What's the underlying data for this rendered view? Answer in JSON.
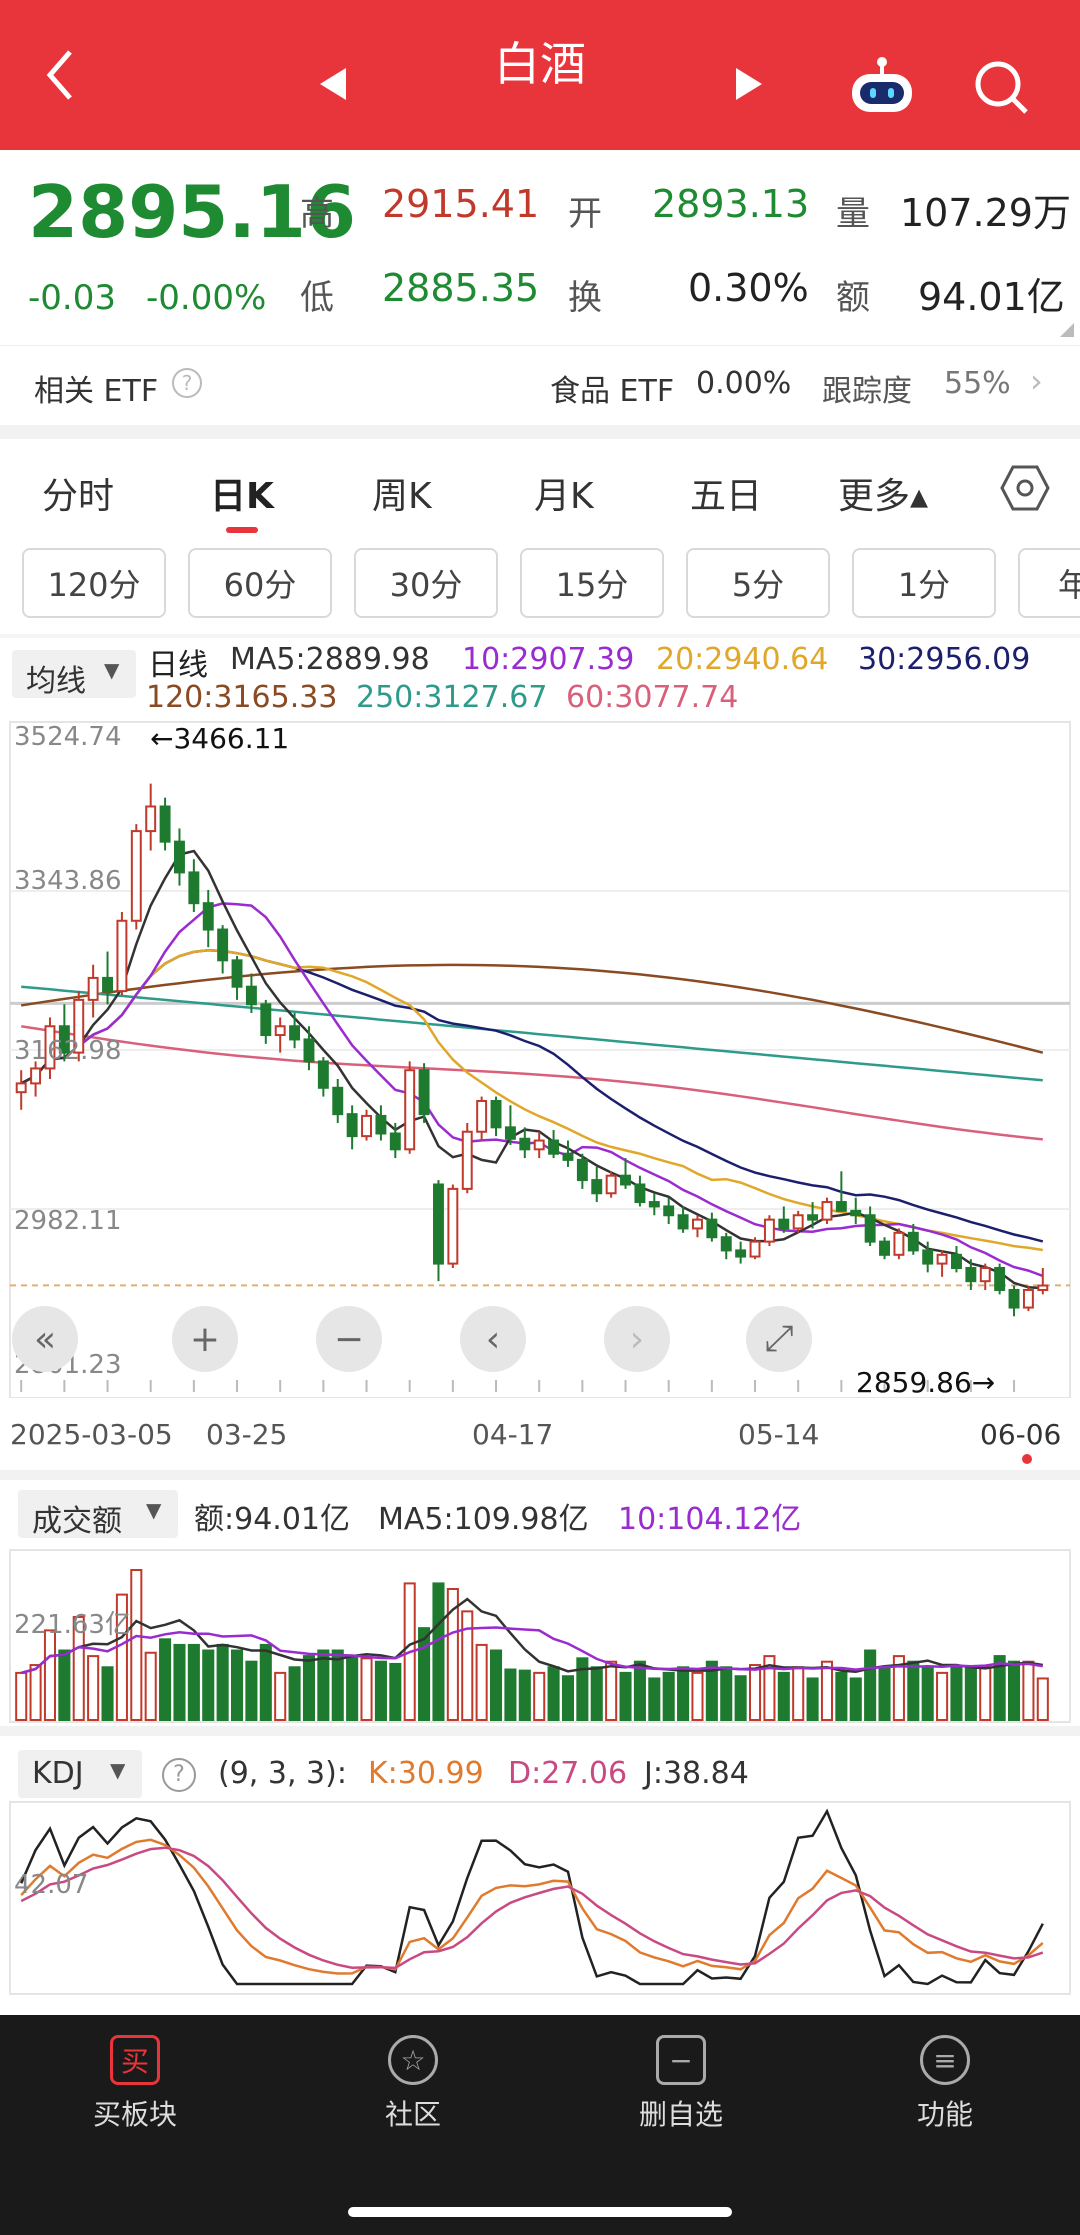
{
  "header": {
    "title": "白酒",
    "back_icon": "back-chevron-icon",
    "prev_icon": "prev-triangle-icon",
    "next_icon": "next-triangle-icon",
    "assistant_icon": "robot-assistant-icon",
    "search_icon": "search-icon",
    "bg_color": "#e8353b"
  },
  "quote": {
    "price": "2895.16",
    "change": "-0.03",
    "change_pct": "-0.00%",
    "high_label": "高",
    "high": "2915.41",
    "open_label": "开",
    "open": "2893.13",
    "volume_label": "量",
    "volume": "107.29万",
    "low_label": "低",
    "low": "2885.35",
    "turnover_label": "换",
    "turnover": "0.30%",
    "amount_label": "额",
    "amount": "94.01亿"
  },
  "etf": {
    "label": "相关 ETF",
    "name": "食品 ETF",
    "pct": "0.00%",
    "track_label": "跟踪度",
    "track_value": "55%"
  },
  "tabs": [
    "分时",
    "日K",
    "周K",
    "月K",
    "五日",
    "更多▴"
  ],
  "active_tab": 1,
  "settings_icon": "hexagon-settings-icon",
  "intervals": [
    "120分",
    "60分",
    "30分",
    "15分",
    "5分",
    "1分",
    "年"
  ],
  "main_chart": {
    "mode_label": "均线",
    "period_label": "日线",
    "ma_legend_row1": [
      {
        "text": "MA5:2889.98",
        "color": "#333333"
      },
      {
        "text": "10:2907.39",
        "color": "#9a2bd1"
      },
      {
        "text": "20:2940.64",
        "color": "#e0a72a"
      },
      {
        "text": "30:2956.09",
        "color": "#1c1f6e"
      }
    ],
    "ma_legend_row2": [
      {
        "text": "120:3165.33",
        "color": "#8a4a22"
      },
      {
        "text": "250:3127.67",
        "color": "#2e9b8a"
      },
      {
        "text": "60:3077.74",
        "color": "#d9607a"
      }
    ],
    "y_labels": [
      "3524.74",
      "3343.86",
      "3162.98",
      "2982.11",
      "2801.23"
    ],
    "high_marker": "←3466.11",
    "low_marker": "2859.86→",
    "x_labels": [
      "2025-03-05",
      "03-25",
      "04-17",
      "05-14",
      "06-06"
    ],
    "controls": [
      "«",
      "+",
      "−",
      "‹",
      "›",
      "⤢"
    ]
  },
  "chart_data": {
    "type": "candlestick",
    "y_range": [
      2801.23,
      3524.74
    ],
    "candles_ohlc": [
      [
        3115,
        3140,
        3095,
        3125
      ],
      [
        3125,
        3150,
        3110,
        3142
      ],
      [
        3142,
        3200,
        3130,
        3190
      ],
      [
        3190,
        3215,
        3150,
        3160
      ],
      [
        3160,
        3230,
        3150,
        3220
      ],
      [
        3220,
        3260,
        3200,
        3245
      ],
      [
        3245,
        3275,
        3215,
        3230
      ],
      [
        3230,
        3320,
        3225,
        3310
      ],
      [
        3310,
        3420,
        3300,
        3412
      ],
      [
        3412,
        3466,
        3390,
        3440
      ],
      [
        3440,
        3450,
        3390,
        3400
      ],
      [
        3400,
        3415,
        3350,
        3365
      ],
      [
        3365,
        3380,
        3320,
        3330
      ],
      [
        3330,
        3345,
        3280,
        3300
      ],
      [
        3300,
        3305,
        3250,
        3265
      ],
      [
        3265,
        3270,
        3220,
        3235
      ],
      [
        3235,
        3250,
        3205,
        3215
      ],
      [
        3215,
        3220,
        3170,
        3180
      ],
      [
        3180,
        3200,
        3160,
        3190
      ],
      [
        3190,
        3205,
        3165,
        3175
      ],
      [
        3175,
        3190,
        3140,
        3150
      ],
      [
        3150,
        3155,
        3110,
        3120
      ],
      [
        3120,
        3130,
        3080,
        3090
      ],
      [
        3090,
        3100,
        3050,
        3065
      ],
      [
        3065,
        3095,
        3060,
        3088
      ],
      [
        3088,
        3100,
        3060,
        3068
      ],
      [
        3068,
        3080,
        3040,
        3050
      ],
      [
        3050,
        3150,
        3045,
        3140
      ],
      [
        3140,
        3148,
        3080,
        3090
      ],
      [
        3010,
        3015,
        2900,
        2920
      ],
      [
        2920,
        3010,
        2915,
        3005
      ],
      [
        3005,
        3080,
        3000,
        3070
      ],
      [
        3070,
        3110,
        3060,
        3105
      ],
      [
        3105,
        3110,
        3065,
        3075
      ],
      [
        3075,
        3100,
        3055,
        3062
      ],
      [
        3062,
        3075,
        3040,
        3050
      ],
      [
        3050,
        3070,
        3040,
        3060
      ],
      [
        3060,
        3072,
        3040,
        3045
      ],
      [
        3045,
        3060,
        3030,
        3038
      ],
      [
        3038,
        3045,
        3005,
        3015
      ],
      [
        3015,
        3030,
        2990,
        3000
      ],
      [
        3000,
        3025,
        2995,
        3020
      ],
      [
        3020,
        3040,
        3005,
        3010
      ],
      [
        3010,
        3020,
        2985,
        2990
      ],
      [
        2990,
        3000,
        2975,
        2985
      ],
      [
        2985,
        2995,
        2965,
        2975
      ],
      [
        2975,
        2985,
        2955,
        2960
      ],
      [
        2960,
        2975,
        2950,
        2970
      ],
      [
        2970,
        2978,
        2945,
        2950
      ],
      [
        2950,
        2955,
        2925,
        2935
      ],
      [
        2935,
        2945,
        2920,
        2928
      ],
      [
        2928,
        2950,
        2925,
        2945
      ],
      [
        2945,
        2975,
        2940,
        2970
      ],
      [
        2970,
        2985,
        2955,
        2960
      ],
      [
        2960,
        2980,
        2955,
        2975
      ],
      [
        2975,
        2990,
        2960,
        2970
      ],
      [
        2970,
        2995,
        2965,
        2990
      ],
      [
        2990,
        3025,
        2985,
        2980
      ],
      [
        2980,
        2995,
        2965,
        2975
      ],
      [
        2975,
        2985,
        2940,
        2945
      ],
      [
        2945,
        2950,
        2925,
        2930
      ],
      [
        2930,
        2960,
        2925,
        2955
      ],
      [
        2955,
        2965,
        2930,
        2935
      ],
      [
        2935,
        2945,
        2910,
        2920
      ],
      [
        2920,
        2935,
        2905,
        2930
      ],
      [
        2930,
        2940,
        2910,
        2915
      ],
      [
        2915,
        2925,
        2890,
        2900
      ],
      [
        2900,
        2920,
        2890,
        2915
      ],
      [
        2915,
        2920,
        2885,
        2890
      ],
      [
        2890,
        2895,
        2860,
        2870
      ],
      [
        2870,
        2895,
        2866,
        2890
      ],
      [
        2890,
        2915,
        2885,
        2895
      ]
    ]
  },
  "volume_panel": {
    "label": "成交额",
    "amount": "额:94.01亿",
    "ma5": "MA5:109.98亿",
    "ma10": "10:104.12亿",
    "y_label": "221.63亿"
  },
  "kdj_panel": {
    "label": "KDJ",
    "help_icon": "question-circle-icon",
    "params": "(9, 3, 3):",
    "k": "K:30.99",
    "d": "D:27.06",
    "j": "J:38.84",
    "y_label": "42.07"
  },
  "bottom_nav": [
    {
      "label": "买板块",
      "icon": "买",
      "icon_name": "buy-sector-icon"
    },
    {
      "label": "社区",
      "icon": "☆",
      "icon_name": "community-icon"
    },
    {
      "label": "删自选",
      "icon": "−",
      "icon_name": "remove-watchlist-icon"
    },
    {
      "label": "功能",
      "icon": "≡",
      "icon_name": "functions-icon"
    }
  ],
  "colors": {
    "up": "#c0392b",
    "down": "#1e7a2e",
    "accent": "#e8353b"
  }
}
